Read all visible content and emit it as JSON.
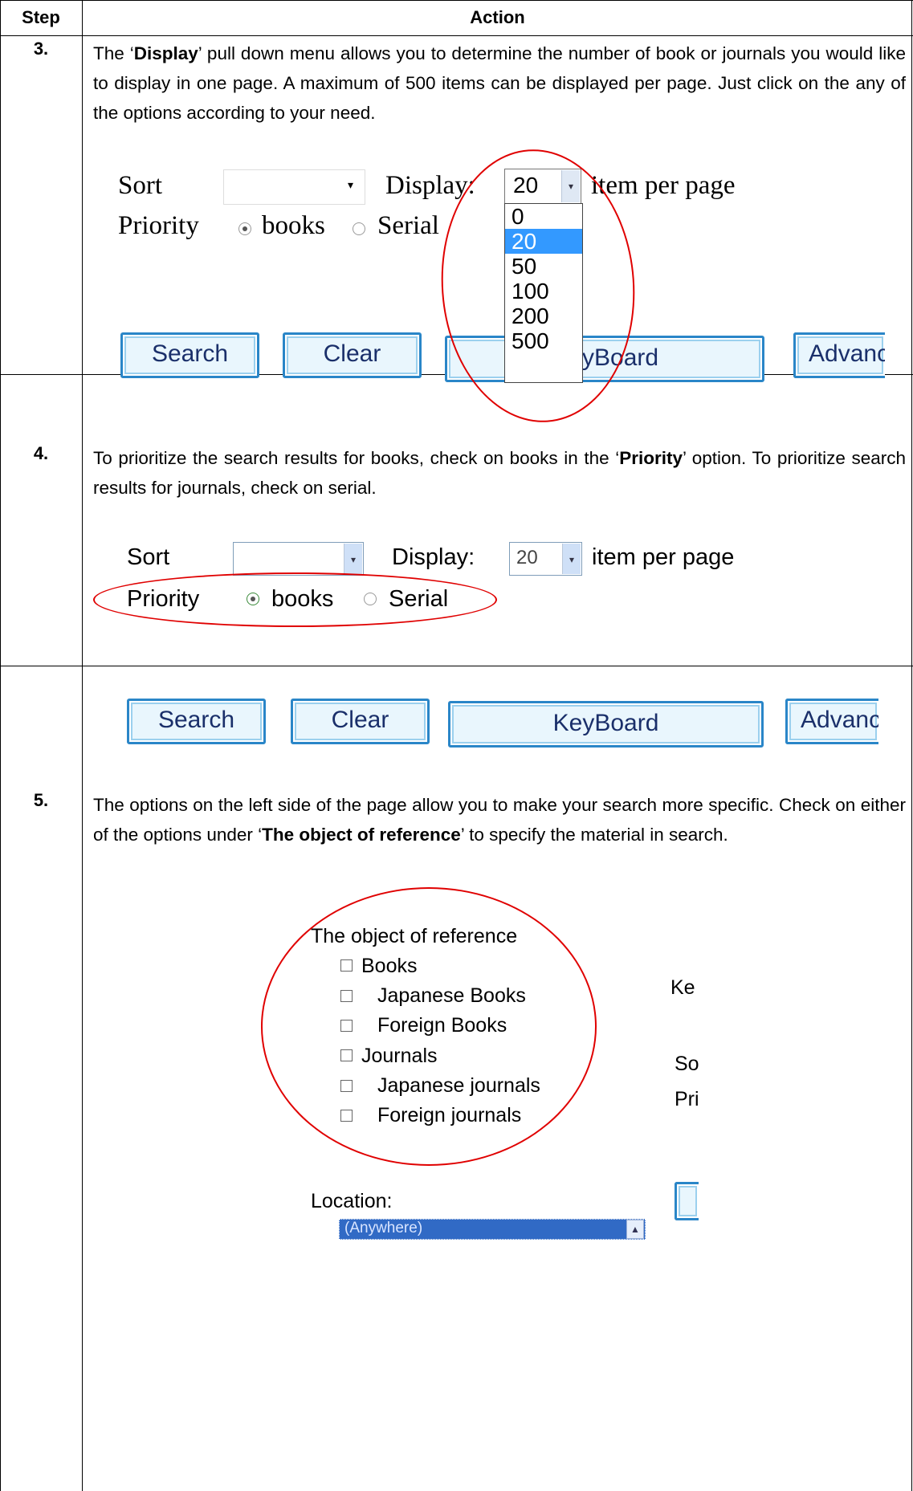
{
  "header": {
    "step": "Step",
    "action": "Action"
  },
  "rows": [
    {
      "step": "3.",
      "para_before": "The ‘",
      "bold": "Display",
      "para_after": "’ pull down menu allows you to determine the number of book or journals you would like to display in one page. A maximum of 500 items can be displayed per page. Just click on the any of the options according to your need.",
      "shot": {
        "sort_label": "Sort",
        "display_label": "Display:",
        "display_value": "20",
        "per_page": "item per page",
        "priority_label": "Priority",
        "books": "books",
        "serial": "Serial",
        "options": [
          "0",
          "20",
          "50",
          "100",
          "200",
          "500"
        ],
        "selected_option": "20",
        "search": "Search",
        "clear": "Clear",
        "keyboard_partial": "yBoard",
        "advanced_partial": "Advanc"
      }
    },
    {
      "step": "4.",
      "para_1": "To prioritize the search results for books, check on books in the ‘",
      "bold": "Priority",
      "para_2": "’ option. To prioritize search results for journals, check on serial.",
      "shot": {
        "sort_label": "Sort",
        "display_label": "Display:",
        "display_value": "20",
        "per_page": "item per page",
        "priority_label": "Priority",
        "books": "books",
        "serial": "Serial",
        "search": "Search",
        "clear": "Clear",
        "keyboard": "KeyBoard",
        "advanced_partial": "Advanc"
      }
    },
    {
      "step": "5.",
      "para_1": "The options on the left side of the page allow you to make your search more specific. Check on either of the options under ‘",
      "bold": "The object of reference",
      "para_2": "’ to specify the material in search.",
      "shot": {
        "heading": "The object of reference",
        "items": [
          "Books",
          "Japanese Books",
          "Foreign Books",
          "Journals",
          "Japanese journals",
          "Foreign journals"
        ],
        "location_label": "Location:",
        "location_value": "(Anywhere)",
        "right_1": "Ke",
        "right_2": "So",
        "right_3": "Pri"
      }
    }
  ],
  "colors": {
    "highlight_ellipse": "#e00000",
    "button_border": "#2a86c8",
    "list_selected": "#3399ff",
    "location_selected": "#316ac5"
  }
}
